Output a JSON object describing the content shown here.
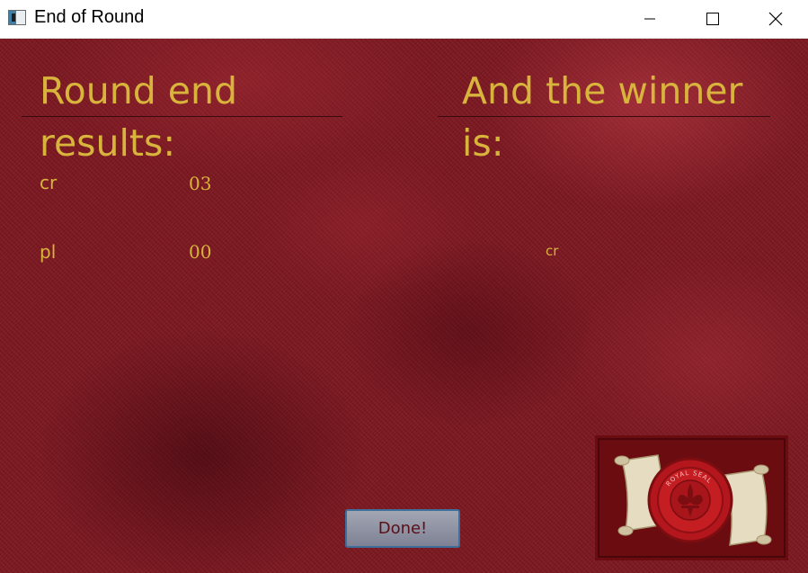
{
  "window": {
    "title": "End of Round",
    "icon": "app-window-icon",
    "controls": [
      "minimize-icon",
      "maximize-icon",
      "close-icon"
    ]
  },
  "results": {
    "heading_line1": "Round end",
    "heading_line2": "results:",
    "rows": [
      {
        "player": "cr",
        "score": "03"
      },
      {
        "player": "pl",
        "score": "00"
      }
    ]
  },
  "winner": {
    "heading_line1": "And the winner",
    "heading_line2": "is:",
    "name": "cr"
  },
  "actions": {
    "done_label": "Done!"
  },
  "seal": {
    "icon": "royal-seal-scroll-icon",
    "lettering": "ROYAL SEAL"
  },
  "colors": {
    "accent_gold": "#d8b43c",
    "background_red": "#7d1821",
    "button_border": "#3e6f9c",
    "button_text": "#5a1018"
  }
}
